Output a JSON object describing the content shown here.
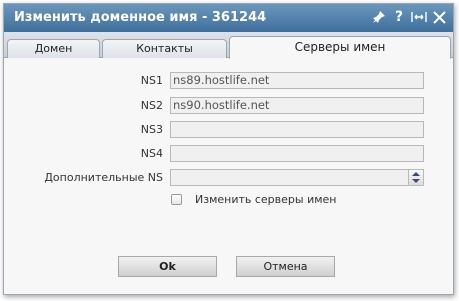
{
  "dialog": {
    "title": "Изменить доменное имя - 361244",
    "icons": [
      "pin-icon",
      "help-icon",
      "resize-icon",
      "close-icon"
    ]
  },
  "tabs": [
    {
      "label": "Домен",
      "active": false
    },
    {
      "label": "Контакты",
      "active": false
    },
    {
      "label": "Серверы имен",
      "active": true
    }
  ],
  "form": {
    "ns1": {
      "label": "NS1",
      "value": "ns89.hostlife.net"
    },
    "ns2": {
      "label": "NS2",
      "value": "ns90.hostlife.net"
    },
    "ns3": {
      "label": "NS3",
      "value": ""
    },
    "ns4": {
      "label": "NS4",
      "value": ""
    },
    "extra_ns": {
      "label": "Дополнительные NS",
      "value": ""
    },
    "change_ns": {
      "label": "Изменить серверы имен",
      "checked": false
    }
  },
  "buttons": {
    "ok": "Ok",
    "cancel": "Отмена"
  }
}
